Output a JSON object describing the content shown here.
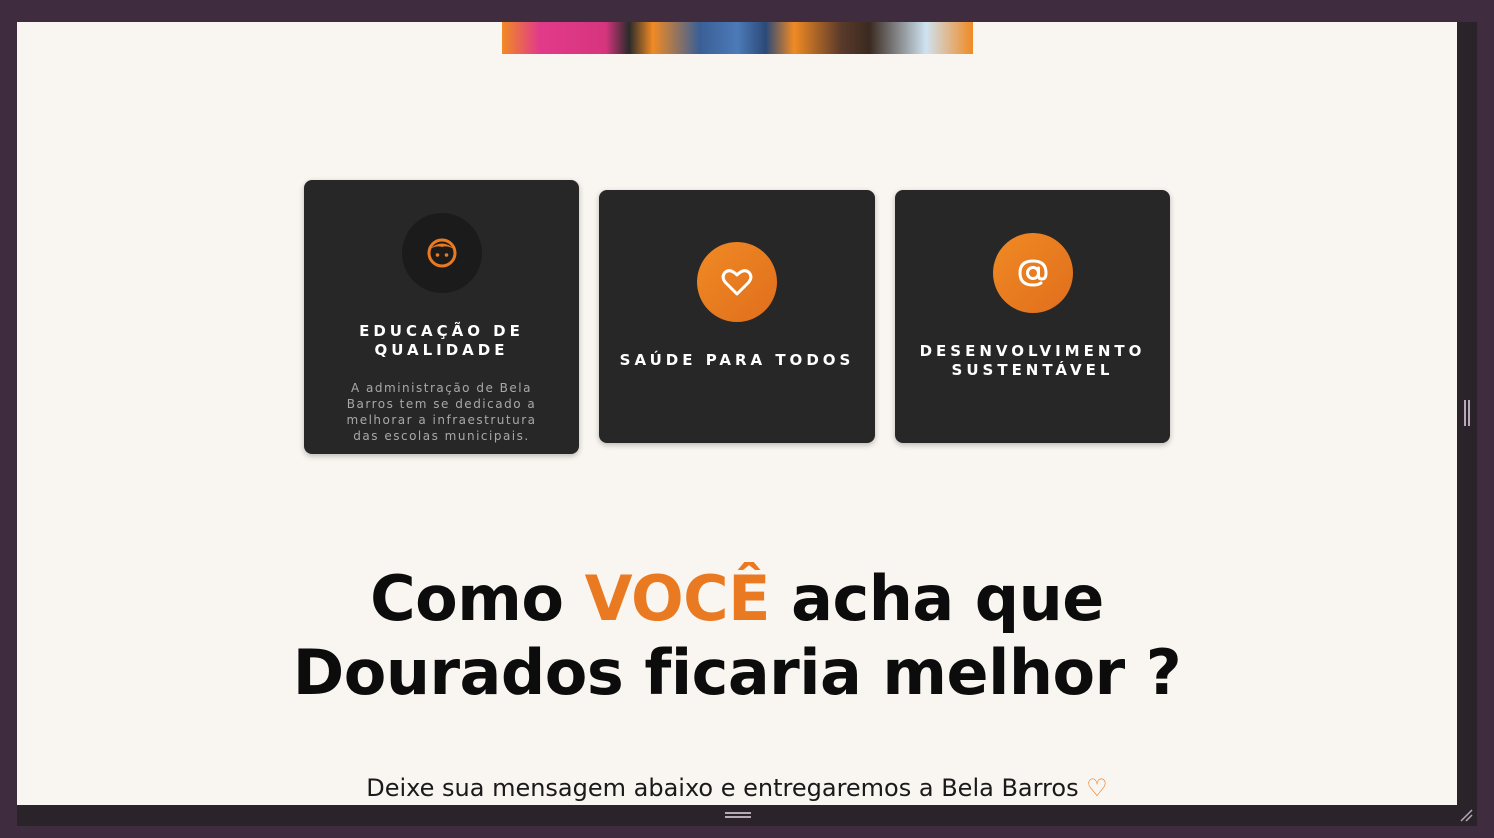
{
  "cards": [
    {
      "title": "EDUCAÇÃO DE QUALIDADE",
      "description": "A administração de Bela Barros tem se dedicado a melhorar a infraestrutura das escolas municipais.",
      "icon": "child-face-icon"
    },
    {
      "title": "SAÚDE PARA TODOS",
      "icon": "heart-icon"
    },
    {
      "title": "DESENVOLVIMENTO SUSTENTÁVEL",
      "icon": "at-sign-icon"
    }
  ],
  "headline": {
    "part1": "Como ",
    "accent": "VOCÊ",
    "part2": " acha que",
    "line2": "Dourados ficaria melhor ?"
  },
  "subline": {
    "text": "Deixe sua mensagem abaixo e entregaremos a Bela Barros ",
    "heart": "♡"
  },
  "colors": {
    "accent": "#ea7a22",
    "card_bg": "#272727",
    "page_bg": "#f9f5f0",
    "frame": "#3f2d3f"
  }
}
